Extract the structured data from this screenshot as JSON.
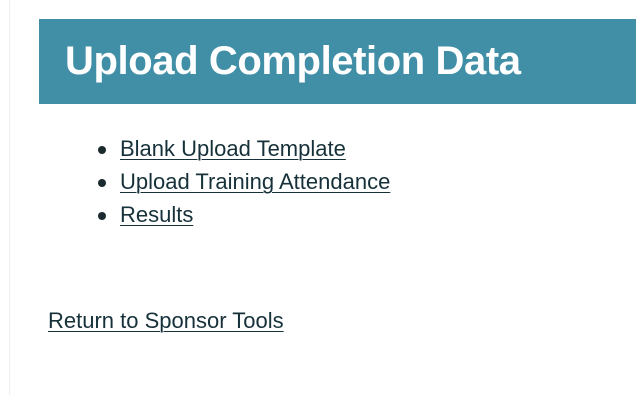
{
  "header": {
    "title": "Upload Completion Data"
  },
  "links": [
    {
      "label": "Blank Upload Template"
    },
    {
      "label": "Upload Training Attendance"
    },
    {
      "label": "Results"
    }
  ],
  "footer": {
    "return_label": "Return to Sponsor Tools"
  },
  "colors": {
    "header_background": "#418fa6",
    "header_text": "#ffffff",
    "link_text": "#16313a"
  }
}
